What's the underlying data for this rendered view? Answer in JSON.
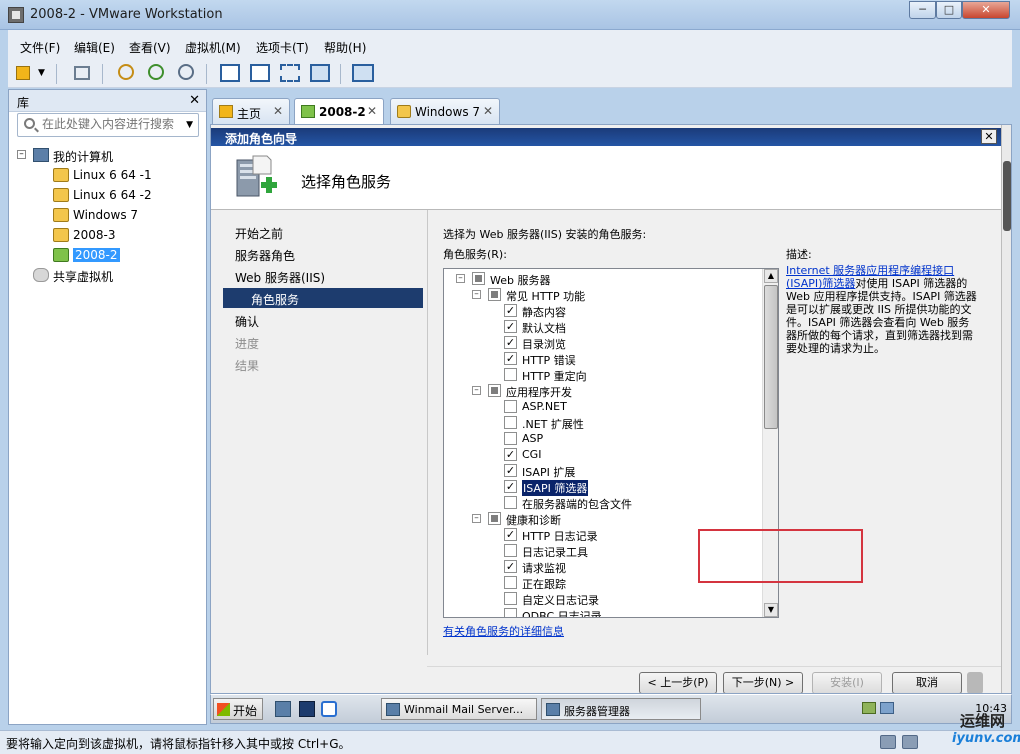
{
  "window": {
    "title": "2008-2 - VMware Workstation"
  },
  "menu": [
    "文件(F)",
    "编辑(E)",
    "查看(V)",
    "虚拟机(M)",
    "选项卡(T)",
    "帮助(H)"
  ],
  "library": {
    "title": "库",
    "search_placeholder": "在此处键入内容进行搜索",
    "root": "我的计算机",
    "vms": [
      "Linux 6 64 -1",
      "Linux 6 64 -2",
      "Windows 7",
      "2008-3",
      "2008-2"
    ],
    "selected": "2008-2",
    "shared": "共享虚拟机"
  },
  "tabs": [
    {
      "label": "主页",
      "active": false
    },
    {
      "label": "2008-2",
      "active": true
    },
    {
      "label": "Windows 7",
      "active": false
    }
  ],
  "wizard": {
    "title": "添加角色向导",
    "heading": "选择角色服务",
    "nav": [
      {
        "label": "开始之前",
        "state": "normal"
      },
      {
        "label": "服务器角色",
        "state": "normal"
      },
      {
        "label": "Web 服务器(IIS)",
        "state": "normal"
      },
      {
        "label": "角色服务",
        "state": "current"
      },
      {
        "label": "确认",
        "state": "normal"
      },
      {
        "label": "进度",
        "state": "disabled"
      },
      {
        "label": "结果",
        "state": "disabled"
      }
    ],
    "instruction": "选择为 Web 服务器(IIS) 安装的角色服务:",
    "role_services_label": "角色服务(R):",
    "description_label": "描述:",
    "description_link": "Internet 服务器应用程序编程接口 (ISAPI)筛选器",
    "description_text": "对使用 ISAPI 筛选器的 Web 应用程序提供支持。ISAPI 筛选器是可以扩展或更改 IIS 所提供功能的文件。ISAPI 筛选器会查看向 Web 服务器所做的每个请求，直到筛选器找到需要处理的请求为止。",
    "role_services": [
      {
        "label": "Web 服务器",
        "level": 0,
        "expander": true,
        "state": "partial",
        "highlight": false
      },
      {
        "label": "常见 HTTP 功能",
        "level": 1,
        "expander": true,
        "state": "partial",
        "highlight": false
      },
      {
        "label": "静态内容",
        "level": 2,
        "expander": false,
        "state": "checked",
        "highlight": false
      },
      {
        "label": "默认文档",
        "level": 2,
        "expander": false,
        "state": "checked",
        "highlight": false
      },
      {
        "label": "目录浏览",
        "level": 2,
        "expander": false,
        "state": "checked",
        "highlight": false
      },
      {
        "label": "HTTP 错误",
        "level": 2,
        "expander": false,
        "state": "checked",
        "highlight": false
      },
      {
        "label": "HTTP 重定向",
        "level": 2,
        "expander": false,
        "state": "unchecked",
        "highlight": false
      },
      {
        "label": "应用程序开发",
        "level": 1,
        "expander": true,
        "state": "partial",
        "highlight": false
      },
      {
        "label": "ASP.NET",
        "level": 2,
        "expander": false,
        "state": "unchecked",
        "highlight": false
      },
      {
        "label": ".NET 扩展性",
        "level": 2,
        "expander": false,
        "state": "unchecked",
        "highlight": false
      },
      {
        "label": "ASP",
        "level": 2,
        "expander": false,
        "state": "unchecked",
        "highlight": false
      },
      {
        "label": "CGI",
        "level": 2,
        "expander": false,
        "state": "checked",
        "highlight": false
      },
      {
        "label": "ISAPI 扩展",
        "level": 2,
        "expander": false,
        "state": "checked",
        "highlight": false
      },
      {
        "label": "ISAPI 筛选器",
        "level": 2,
        "expander": false,
        "state": "checked",
        "highlight": true
      },
      {
        "label": "在服务器端的包含文件",
        "level": 2,
        "expander": false,
        "state": "unchecked",
        "highlight": false
      },
      {
        "label": "健康和诊断",
        "level": 1,
        "expander": true,
        "state": "partial",
        "highlight": false
      },
      {
        "label": "HTTP 日志记录",
        "level": 2,
        "expander": false,
        "state": "checked",
        "highlight": false
      },
      {
        "label": "日志记录工具",
        "level": 2,
        "expander": false,
        "state": "unchecked",
        "highlight": false
      },
      {
        "label": "请求监视",
        "level": 2,
        "expander": false,
        "state": "checked",
        "highlight": false
      },
      {
        "label": "正在跟踪",
        "level": 2,
        "expander": false,
        "state": "unchecked",
        "highlight": false
      },
      {
        "label": "自定义日志记录",
        "level": 2,
        "expander": false,
        "state": "unchecked",
        "highlight": false
      },
      {
        "label": "ODBC 日志记录",
        "level": 2,
        "expander": false,
        "state": "unchecked",
        "highlight": false
      }
    ],
    "more_info": "有关角色服务的详细信息",
    "buttons": {
      "prev": "< 上一步(P)",
      "next": "下一步(N) >",
      "install": "安装(I)",
      "cancel": "取消"
    }
  },
  "guest_taskbar": {
    "start": "开始",
    "tasks": [
      {
        "label": "Winmail Mail Server...",
        "active": false
      },
      {
        "label": "服务器管理器",
        "active": true
      }
    ],
    "clock": "10:43"
  },
  "statusbar": {
    "text": "要将输入定向到该虚拟机，请将鼠标指针移入其中或按 Ctrl+G。"
  },
  "watermark": {
    "line1": "运维网",
    "line2": "iyunv.com"
  }
}
